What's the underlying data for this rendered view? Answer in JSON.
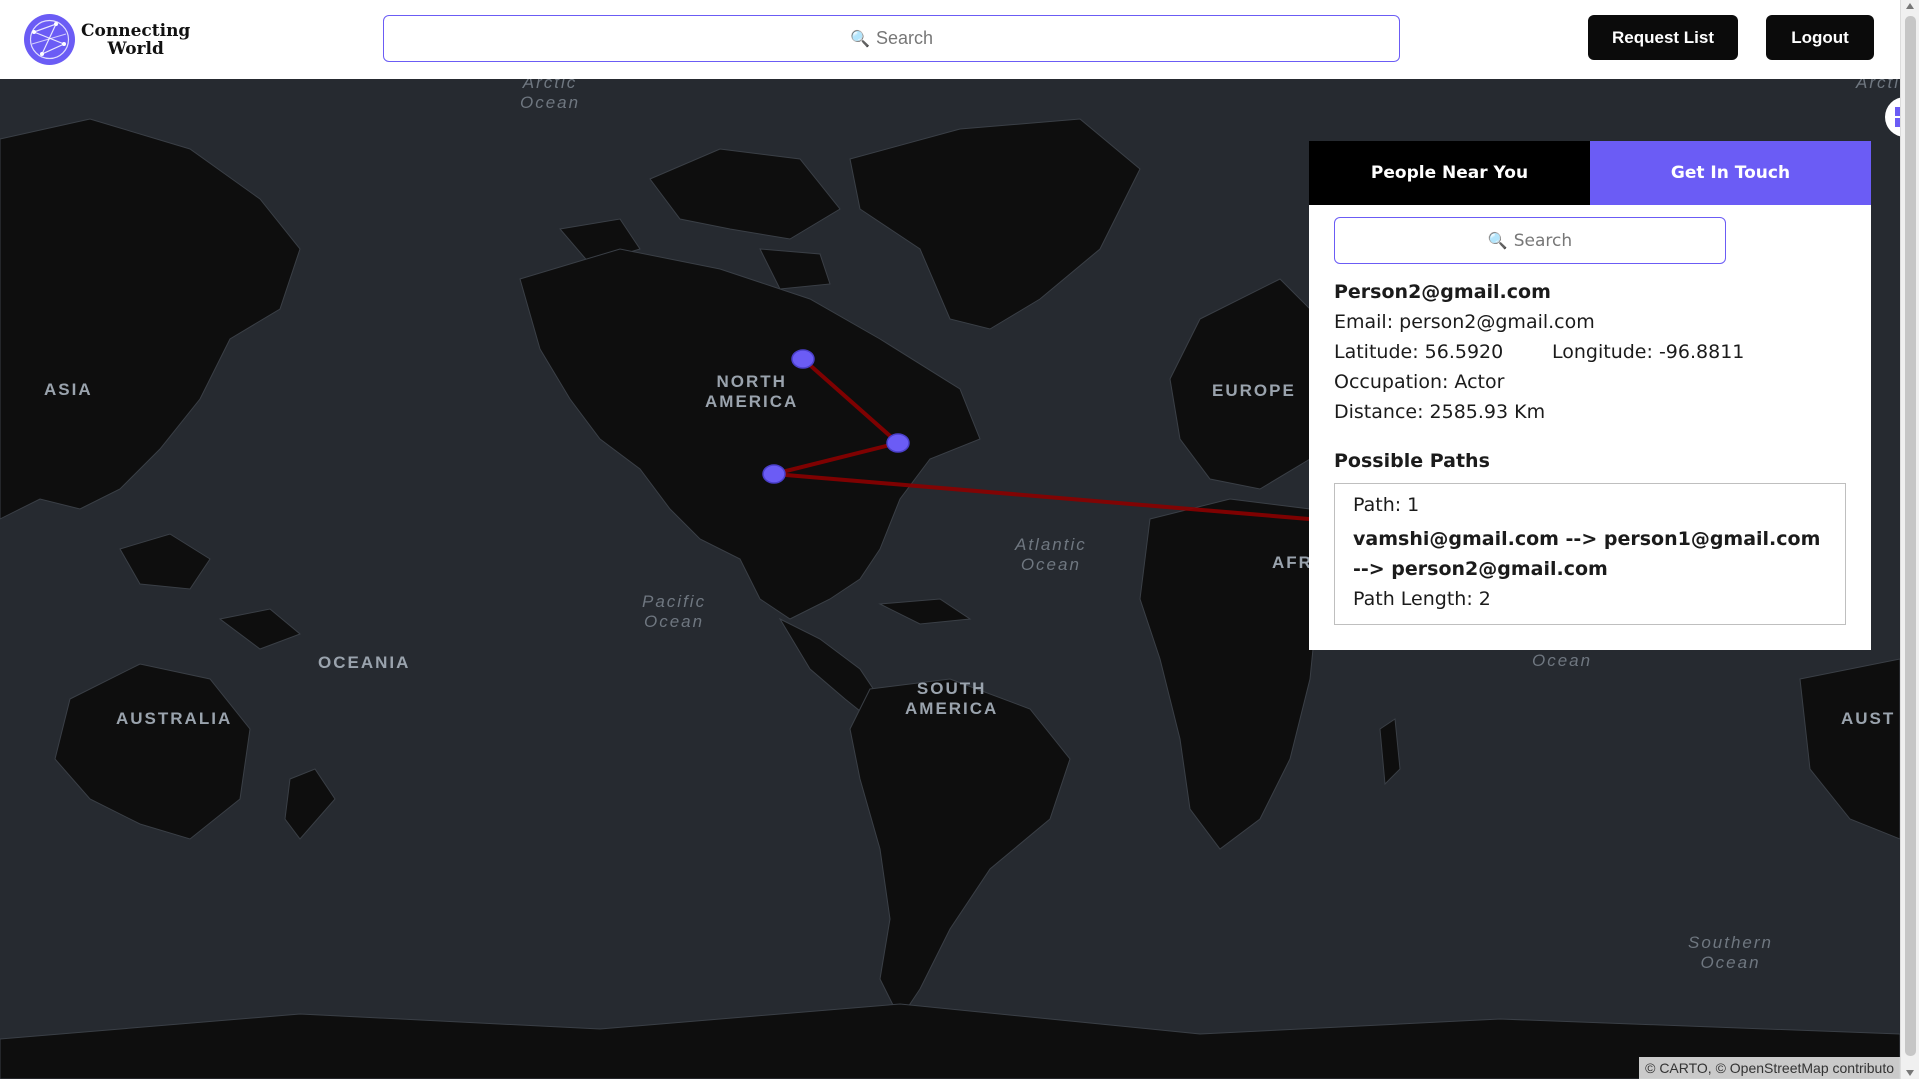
{
  "header": {
    "logo_line1": "Connecting",
    "logo_line2": "World",
    "search_placeholder": "Search",
    "request_list_label": "Request List",
    "logout_label": "Logout"
  },
  "map": {
    "continent_labels": {
      "asia": "ASIA",
      "north_america_line1": "NORTH",
      "north_america_line2": "AMERICA",
      "europe": "EUROPE",
      "africa": "AFR",
      "oceania": "OCEANIA",
      "australia": "AUSTRALIA",
      "australia_right": "AUST",
      "south_america_line1": "SOUTH",
      "south_america_line2": "AMERICA"
    },
    "ocean_labels": {
      "arctic_line1": "Arctic",
      "arctic_line2": "Ocean",
      "arctic_right": "Arcti",
      "atlantic_line1": "Atlantic",
      "atlantic_line2": "Ocean",
      "pacific_line1": "Pacific",
      "pacific_line2": "Ocean",
      "indian_partial": "Ocean",
      "southern_line1": "Southern",
      "southern_line2": "Ocean"
    },
    "attribution": "© CARTO, © OpenStreetMap contributo",
    "marker_color": "#6b5cf5",
    "path_color": "#8b0000"
  },
  "panel": {
    "tabs": [
      {
        "label": "People Near You"
      },
      {
        "label": "Get In Touch"
      }
    ],
    "search_placeholder": "Search",
    "person": {
      "title": "Person2@gmail.com",
      "email": "Email: person2@gmail.com",
      "latitude": "Latitude: 56.5920",
      "longitude": "Longitude: -96.8811",
      "occupation": "Occupation: Actor",
      "distance": "Distance: 2585.93 Km"
    },
    "paths_heading": "Possible Paths",
    "paths": [
      {
        "number": "Path: 1",
        "route": "vamshi@gmail.com --> person1@gmail.com --> person2@gmail.com",
        "length": "Path Length: 2"
      }
    ]
  },
  "colors": {
    "accent": "#6b5cf5",
    "map_ocean": "#262a30",
    "map_land": "#0e0e0e"
  }
}
